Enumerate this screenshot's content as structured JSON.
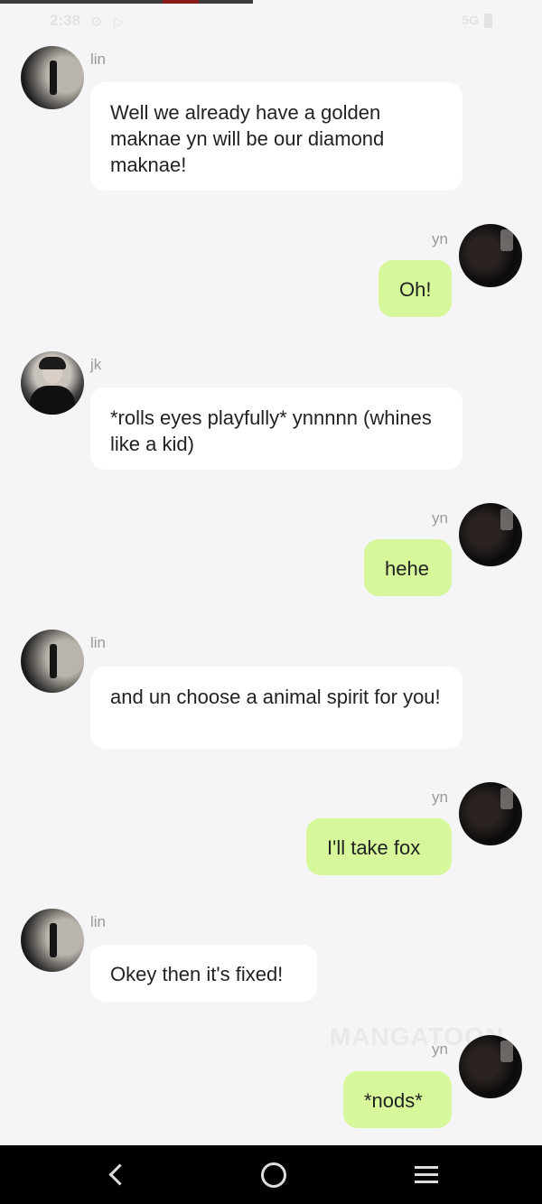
{
  "status_bar": {
    "time": "2:38",
    "network": "5G"
  },
  "watermark": "MANGATOON",
  "messages": [
    {
      "sender": "lin",
      "text": "Well we already have a golden maknae yn will be our diamond maknae!"
    },
    {
      "sender": "yn",
      "text": "Oh!"
    },
    {
      "sender": "jk",
      "text": "*rolls eyes playfully* ynnnnn (whines like a kid)"
    },
    {
      "sender": "yn",
      "text": "hehe"
    },
    {
      "sender": "lin",
      "text": "and un choose a animal spirit for you!"
    },
    {
      "sender": "yn",
      "text": "I'll take fox"
    },
    {
      "sender": "lin",
      "text": "Okey then it's fixed!"
    },
    {
      "sender": "yn",
      "text": "*nods*"
    }
  ],
  "colors": {
    "incoming_bubble": "#ffffff",
    "outgoing_bubble": "#d6f79a",
    "background": "#f5f5f7"
  },
  "icons": [
    "back-icon",
    "home-icon",
    "menu-icon"
  ]
}
